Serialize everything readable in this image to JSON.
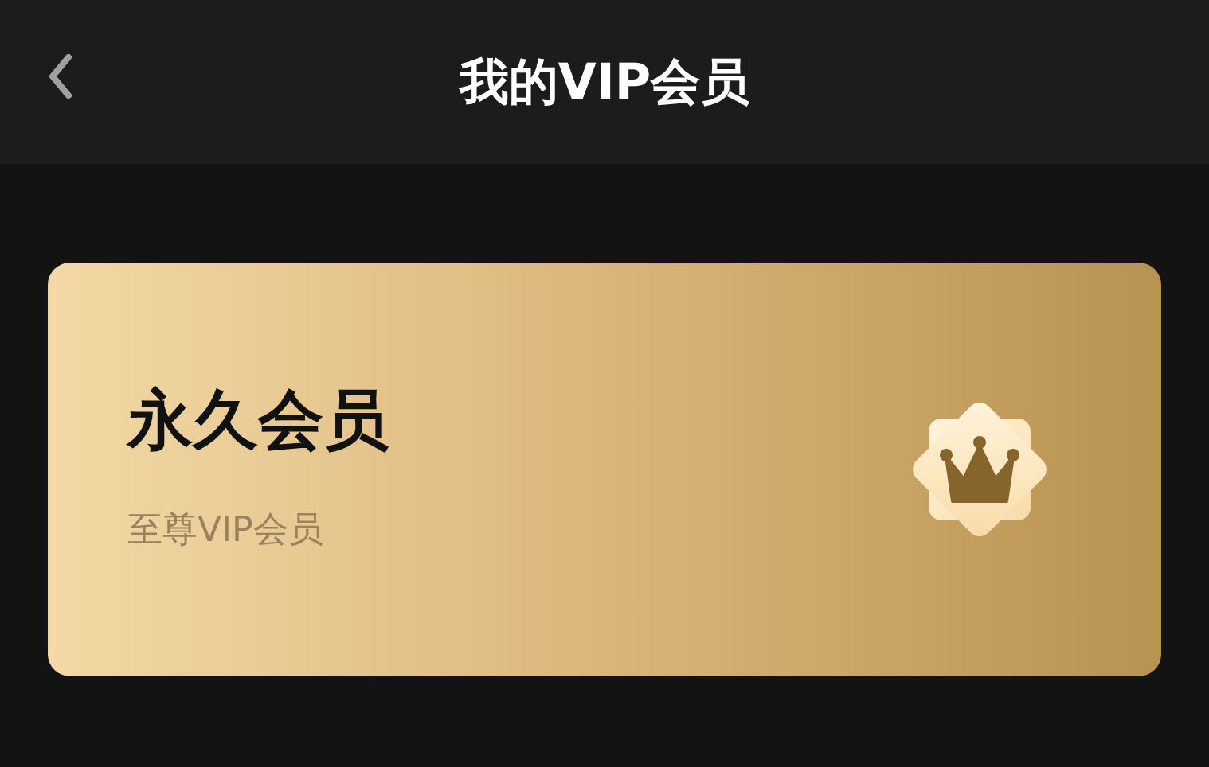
{
  "header": {
    "title": "我的VIP会员"
  },
  "card": {
    "title": "永久会员",
    "subtitle": "至尊VIP会员"
  }
}
